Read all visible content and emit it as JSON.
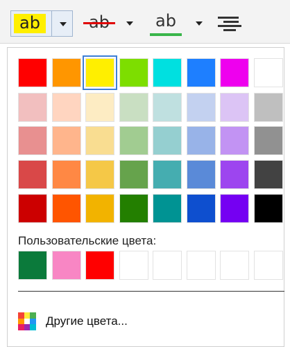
{
  "toolbar": {
    "highlight_glyph": "ab",
    "strikethrough_glyph": "ab",
    "underline_glyph": "ab",
    "highlight_color": "#ffef00",
    "strike_color": "#e00000",
    "underline_color": "#39b54a"
  },
  "standard_colors": [
    [
      "#ff0000",
      "#ff9600",
      "#ffef00",
      "#7dde00",
      "#00e0e0",
      "#1e7fff",
      "#ee00ee",
      "#ffffff"
    ],
    [
      "#f2bfbf",
      "#ffd5c0",
      "#fdecc3",
      "#c9dfc2",
      "#bfe0e0",
      "#c3d1f0",
      "#dcc4f5",
      "#bfbfbf"
    ],
    [
      "#e89090",
      "#ffb58c",
      "#f9dd91",
      "#a1cc91",
      "#95cfd0",
      "#98b3e8",
      "#c293f3",
      "#919191"
    ],
    [
      "#d94848",
      "#ff8844",
      "#f5c847",
      "#66a34c",
      "#45adb0",
      "#5a8ad8",
      "#9d45ef",
      "#424242"
    ],
    [
      "#cc0000",
      "#ff5500",
      "#f2b300",
      "#237f00",
      "#009393",
      "#0e4fcf",
      "#7500f2",
      "#000000"
    ]
  ],
  "selected_color": "#ffef00",
  "custom_colors_label": "Пользовательские цвета:",
  "custom_colors": [
    "#0b7a3b",
    "#f886c4",
    "#ff0000",
    "#ffffff",
    "#ffffff",
    "#ffffff",
    "#ffffff",
    "#ffffff"
  ],
  "more_colors_label": "Другие цвета...",
  "more_colors_icon": "color-palette-icon"
}
